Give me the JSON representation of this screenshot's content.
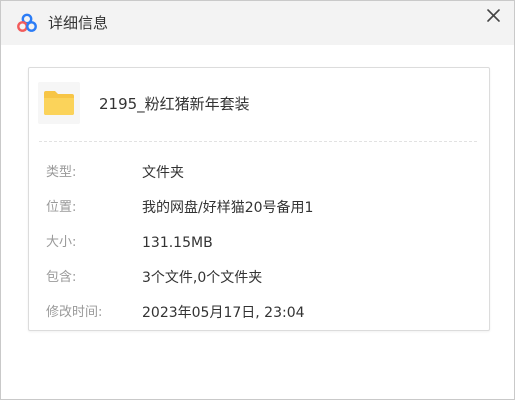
{
  "window": {
    "title": "详细信息",
    "app_icon": "baidu-netdisk-logo",
    "close_icon": "close-icon"
  },
  "file": {
    "icon": "folder-icon",
    "name": "2195_粉红猪新年套装"
  },
  "properties": [
    {
      "label": "类型:",
      "value": "文件夹"
    },
    {
      "label": "位置:",
      "value": "我的网盘/好样猫20号备用1"
    },
    {
      "label": "大小:",
      "value": "131.15MB"
    },
    {
      "label": "包含:",
      "value": "3个文件,0个文件夹"
    },
    {
      "label": "修改时间:",
      "value": "2023年05月17日, 23:04"
    }
  ],
  "colors": {
    "titlebar_bg": "#f3f3f3",
    "folder_yellow": "#f7c545",
    "label_gray": "#9a9a9a",
    "value_text": "#333333",
    "logo_blue": "#2b7cf6",
    "logo_red": "#f25b5b"
  }
}
